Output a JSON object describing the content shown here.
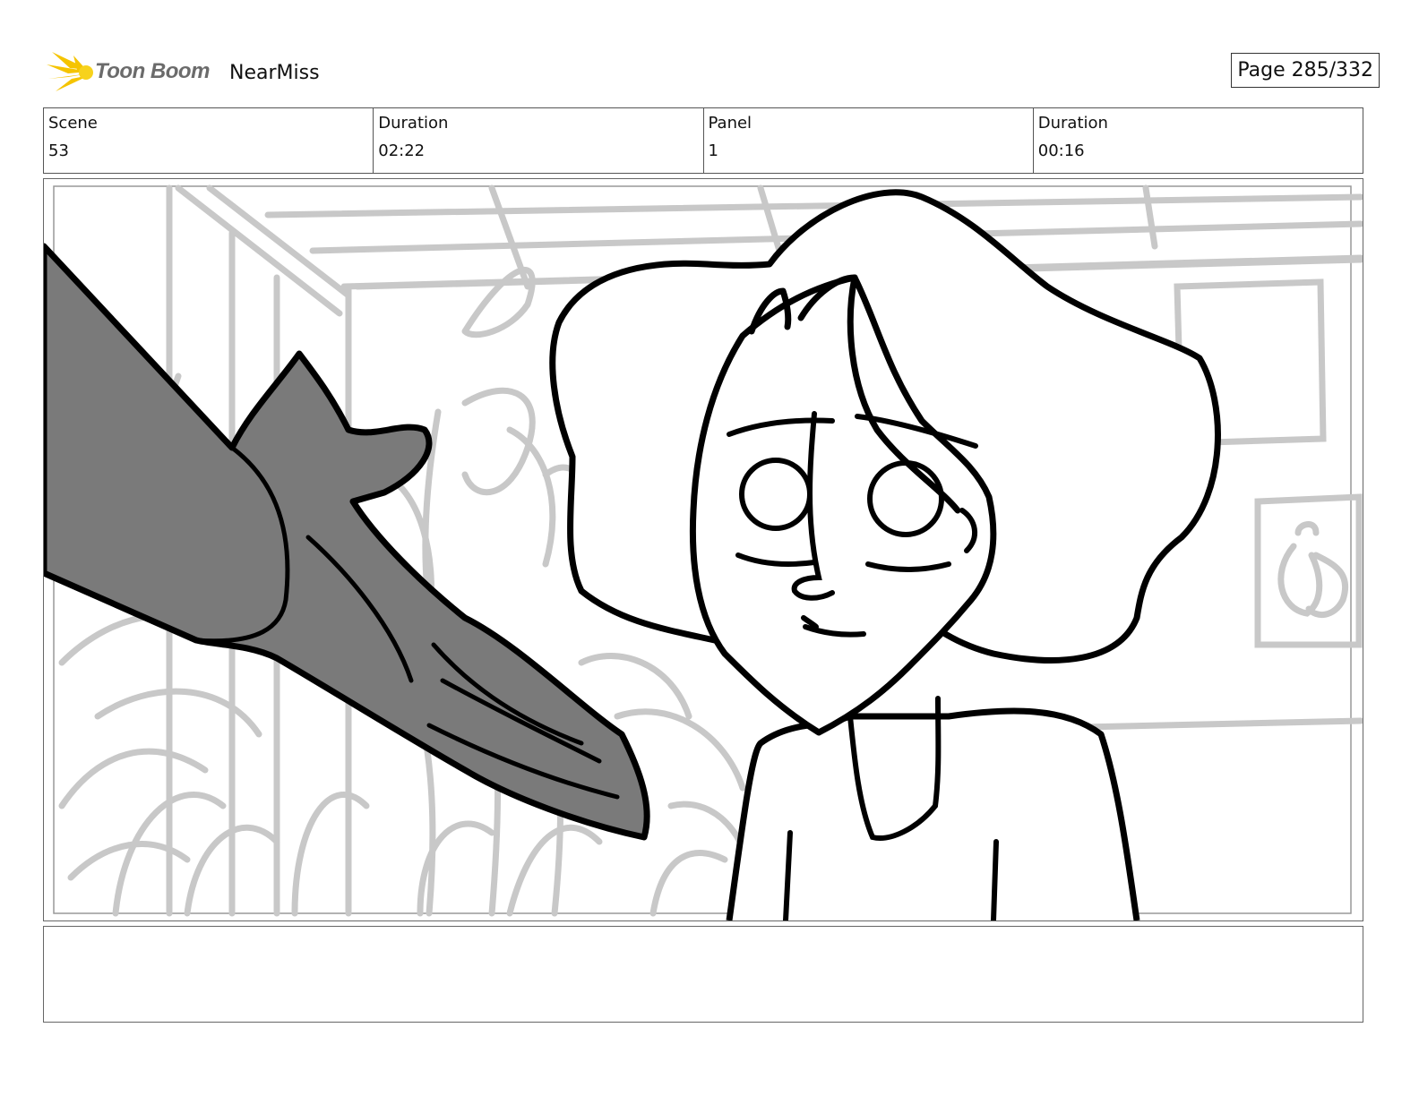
{
  "header": {
    "brand": "Toon Boom",
    "project": "NearMiss",
    "page": "Page 285/332"
  },
  "info": [
    {
      "label": "Scene",
      "value": "53"
    },
    {
      "label": "Duration",
      "value": "02:22"
    },
    {
      "label": "Panel",
      "value": "1"
    },
    {
      "label": "Duration",
      "value": "00:16"
    }
  ],
  "colors": {
    "logo_yellow": "#f5c400",
    "sketch_gray": "#c8c8c8",
    "hand_gray": "#7a7a7a",
    "ink": "#000000"
  },
  "notes": {
    "text": ""
  }
}
